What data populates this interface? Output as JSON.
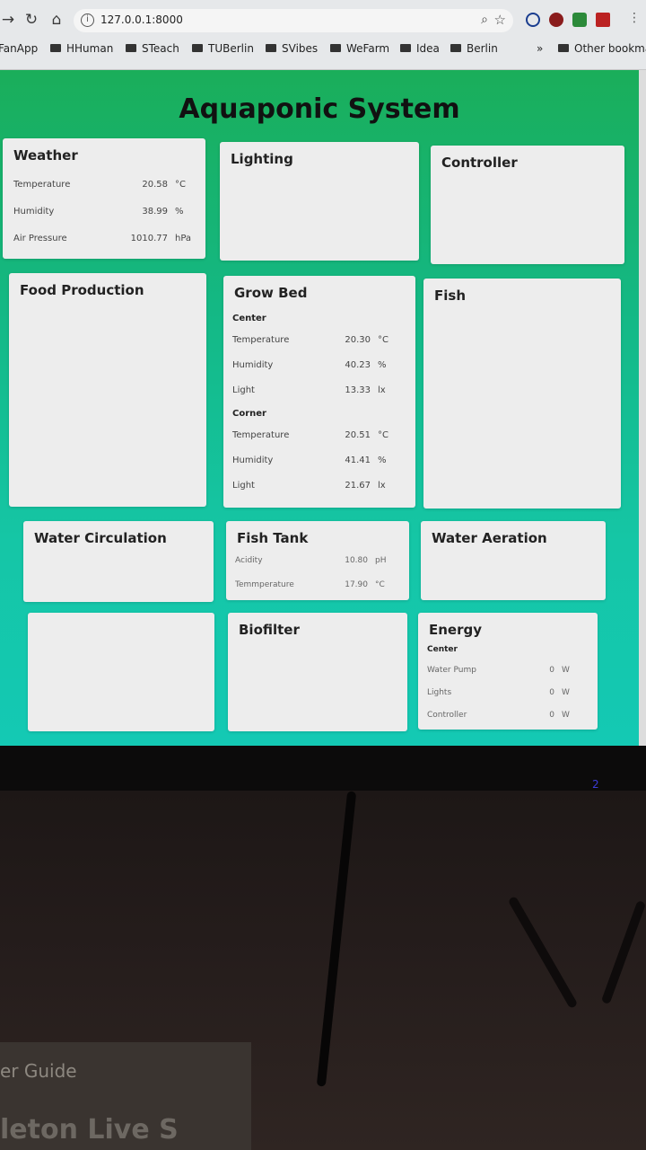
{
  "browser": {
    "url": "127.0.0.1:8000",
    "bookmarks": [
      "FanApp",
      "HHuman",
      "STeach",
      "TUBerlin",
      "SVibes",
      "WeFarm",
      "Idea",
      "Berlin"
    ],
    "more_bookmarks": "»",
    "other_bookmarks": "Other bookma"
  },
  "page": {
    "title": "Aquaponic System"
  },
  "cards": {
    "weather": {
      "title": "Weather",
      "rows": [
        {
          "label": "Temperature",
          "value": "20.58",
          "unit": "°C"
        },
        {
          "label": "Humidity",
          "value": "38.99",
          "unit": "%"
        },
        {
          "label": "Air Pressure",
          "value": "1010.77",
          "unit": "hPa"
        }
      ]
    },
    "lighting": {
      "title": "Lighting"
    },
    "controller": {
      "title": "Controller"
    },
    "food_production": {
      "title": "Food Production"
    },
    "grow_bed": {
      "title": "Grow Bed",
      "center": {
        "heading": "Center",
        "rows": [
          {
            "label": "Temperature",
            "value": "20.30",
            "unit": "°C"
          },
          {
            "label": "Humidity",
            "value": "40.23",
            "unit": "%"
          },
          {
            "label": "Light",
            "value": "13.33",
            "unit": "lx"
          }
        ]
      },
      "corner": {
        "heading": "Corner",
        "rows": [
          {
            "label": "Temperature",
            "value": "20.51",
            "unit": "°C"
          },
          {
            "label": "Humidity",
            "value": "41.41",
            "unit": "%"
          },
          {
            "label": "Light",
            "value": "21.67",
            "unit": "lx"
          }
        ]
      }
    },
    "fish": {
      "title": "Fish"
    },
    "water_circulation": {
      "title": "Water Circulation"
    },
    "fish_tank": {
      "title": "Fish Tank",
      "rows": [
        {
          "label": "Acidity",
          "value": "10.80",
          "unit": "pH"
        },
        {
          "label": "Temmperature",
          "value": "17.90",
          "unit": "°C"
        }
      ]
    },
    "water_aeration": {
      "title": "Water Aeration"
    },
    "blank": {
      "title": ""
    },
    "biofilter": {
      "title": "Biofilter"
    },
    "energy": {
      "title": "Energy",
      "heading": "Center",
      "rows": [
        {
          "label": "Water Pump",
          "value": "0",
          "unit": "W"
        },
        {
          "label": "Lights",
          "value": "0",
          "unit": "W"
        },
        {
          "label": "Controller",
          "value": "0",
          "unit": "W"
        }
      ]
    }
  },
  "photo": {
    "book_text_1": "er Guide",
    "book_text_2": "leton Live S",
    "monitor_led": "2"
  }
}
